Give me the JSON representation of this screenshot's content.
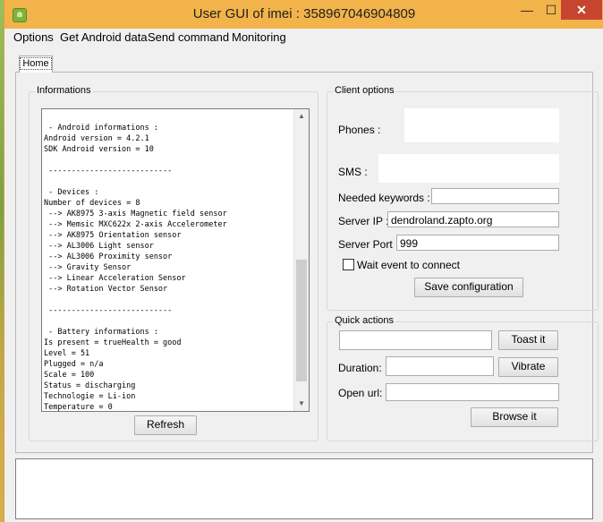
{
  "window": {
    "title": "User GUI of imei : 358967046904809",
    "min_glyph": "—",
    "max_glyph": "☐",
    "close_glyph": "✕"
  },
  "menu": [
    "Options",
    "Get Android data",
    "Send command",
    "Monitoring"
  ],
  "tab": {
    "label": "Home"
  },
  "informations": {
    "title": "Informations",
    "text": " - Android informations :\nAndroid version = 4.2.1\nSDK Android version = 10\n\n ---------------------------\n\n - Devices :\nNumber of devices = 8\n --> AK8975 3-axis Magnetic field sensor\n --> Memsic MXC622x 2-axis Accelerometer\n --> AK8975 Orientation sensor\n --> AL3006 Light sensor\n --> AL3006 Proximity sensor\n --> Gravity Sensor\n --> Linear Acceleration Sensor\n --> Rotation Vector Sensor\n\n ---------------------------\n\n - Battery informations :\nIs present = trueHealth = good\nLevel = 51\nPlugged = n/a\nScale = 100\nStatus = discharging\nTechnologie = Li-ion\nTemperature = 0",
    "scroll_up": "▲",
    "scroll_down": "▼",
    "refresh_label": "Refresh"
  },
  "client_options": {
    "title": "Client options",
    "phones_label": "Phones :",
    "sms_label": "SMS :",
    "keywords_label": "Needed keywords :",
    "keywords_value": "",
    "server_ip_label": "Server IP :",
    "server_ip_value": "dendroland.zapto.org",
    "server_port_label": "Server Port :",
    "server_port_value": "999",
    "wait_event_label": "Wait event to connect",
    "save_label": "Save configuration"
  },
  "quick_actions": {
    "title": "Quick actions",
    "toast_value": "",
    "toast_label": "Toast it",
    "duration_label": "Duration:",
    "duration_value": "",
    "vibrate_label": "Vibrate",
    "open_url_label": "Open url:",
    "open_url_value": "",
    "browse_label": "Browse it"
  }
}
